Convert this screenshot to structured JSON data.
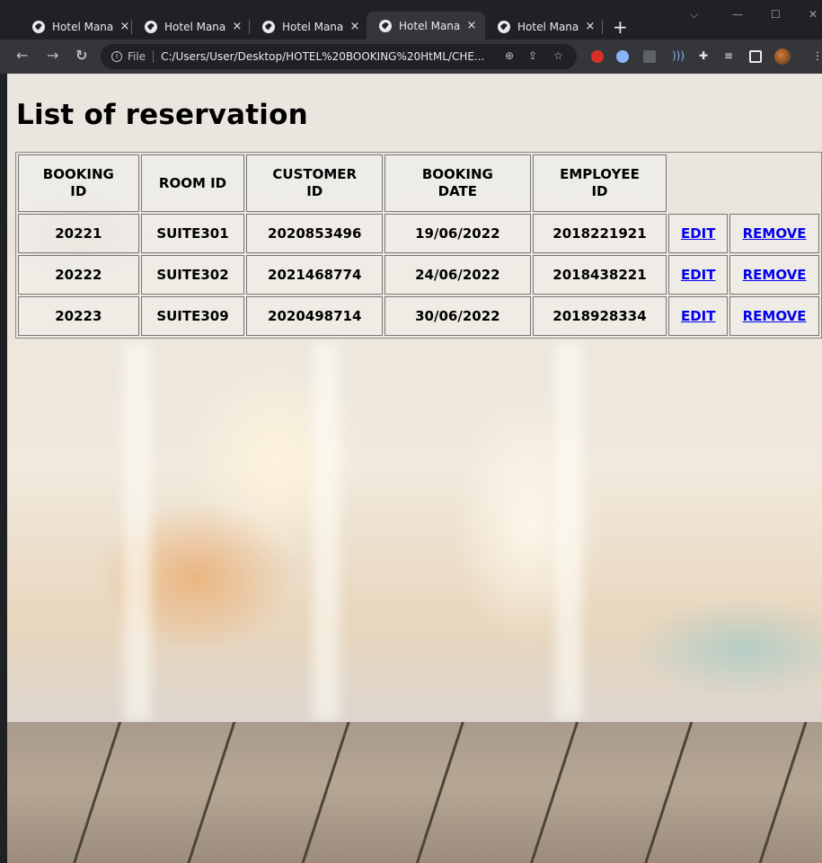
{
  "browser": {
    "tabs": [
      {
        "title": "Hotel Manage"
      },
      {
        "title": "Hotel Manage"
      },
      {
        "title": "Hotel Manage"
      },
      {
        "title": "Hotel Manage",
        "active": true
      },
      {
        "title": "Hotel Manage"
      }
    ],
    "tab_close": "×",
    "new_tab": "+",
    "window_controls": {
      "minimize": "—",
      "maximize": "☐",
      "close": "✕"
    },
    "address": {
      "file_label": "File",
      "url": "C:/Users/User/Desktop/HOTEL%20BOOKING%20HtML/CHE..."
    },
    "icons": [
      "back-icon",
      "forward-icon",
      "reload-icon",
      "info-icon",
      "zoom-icon",
      "share-icon",
      "star-icon",
      "extension-icons",
      "puzzle-icon",
      "reading-list-icon",
      "side-panel-icon",
      "avatar",
      "menu-icon"
    ],
    "colors": {
      "frame": "#202124",
      "toolbar": "#35363a",
      "link": "#0000ee"
    }
  },
  "page": {
    "title": "List of reservation",
    "table": {
      "headers": [
        [
          "BOOKING",
          "ID"
        ],
        [
          "ROOM ID"
        ],
        [
          "CUSTOMER",
          "ID"
        ],
        [
          "BOOKING",
          "DATE"
        ],
        [
          "EMPLOYEE",
          "ID"
        ]
      ],
      "rows": [
        {
          "booking_id": "20221",
          "room_id": "SUITE301",
          "customer_id": "2020853496",
          "booking_date": "19/06/2022",
          "employee_id": "2018221921",
          "edit": "EDIT",
          "remove": "REMOVE"
        },
        {
          "booking_id": "20222",
          "room_id": "SUITE302",
          "customer_id": "2021468774",
          "booking_date": "24/06/2022",
          "employee_id": "2018438221",
          "edit": "EDIT",
          "remove": "REMOVE"
        },
        {
          "booking_id": "20223",
          "room_id": "SUITE309",
          "customer_id": "2020498714",
          "booking_date": "30/06/2022",
          "employee_id": "2018928334",
          "edit": "EDIT",
          "remove": "REMOVE"
        }
      ]
    }
  }
}
